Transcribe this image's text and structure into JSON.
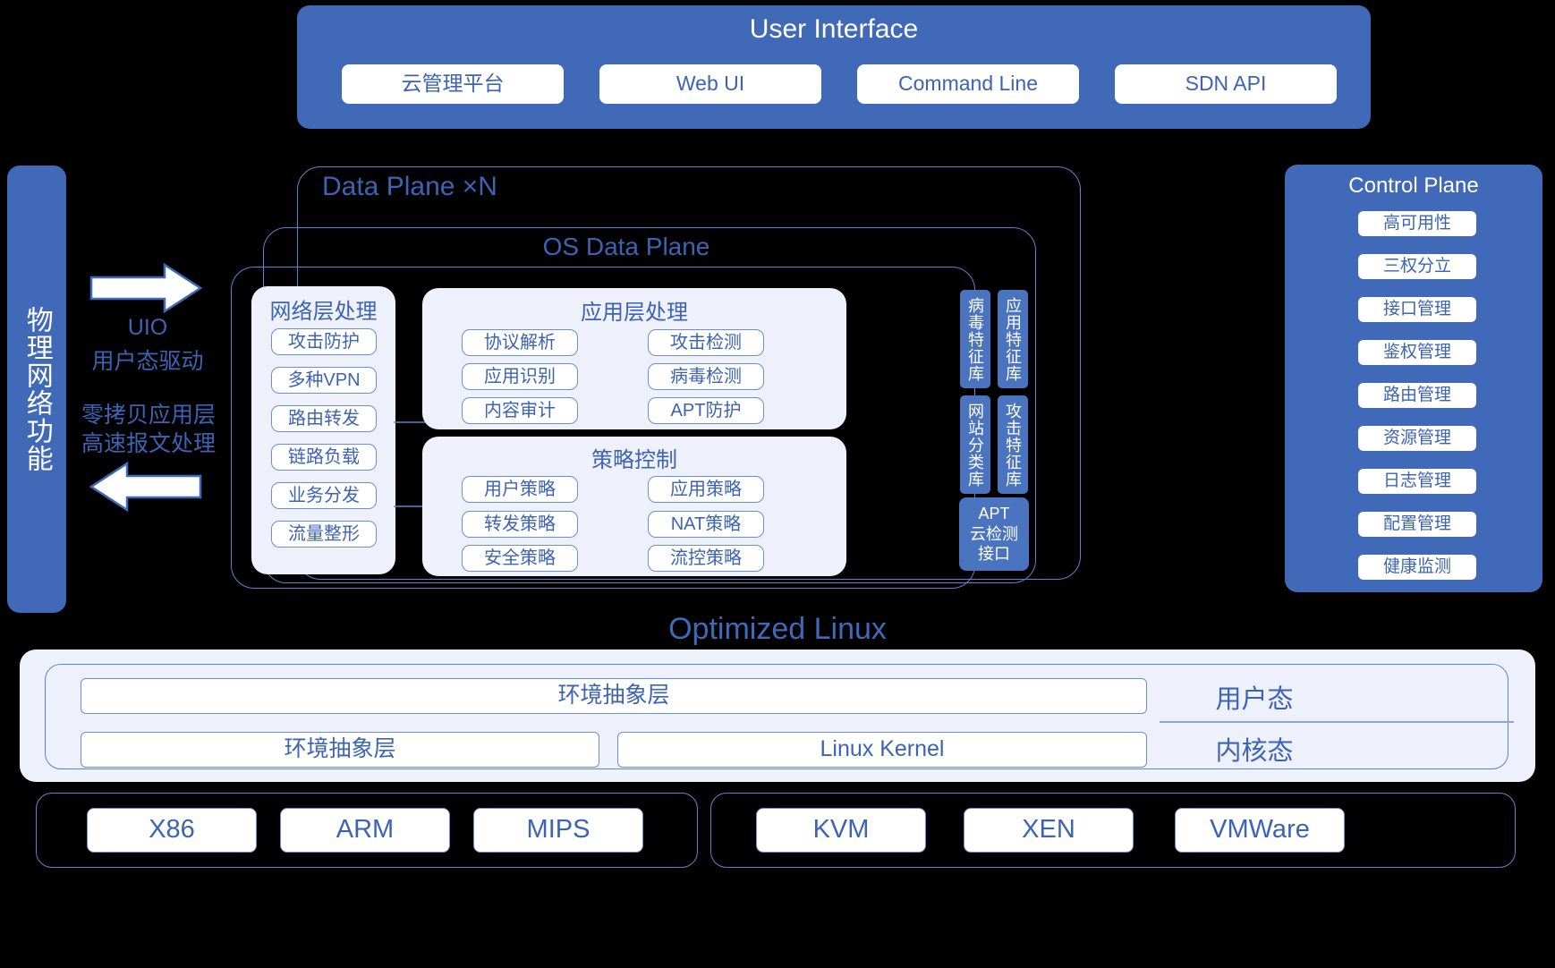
{
  "user_interface": {
    "title": "User Interface",
    "items": [
      "云管理平台",
      "Web UI",
      "Command Line",
      "SDN API"
    ]
  },
  "physical_network": {
    "label": "物理网络功能"
  },
  "flow": {
    "up_arrow_icon": "arrow-right-icon",
    "down_arrow_icon": "arrow-left-icon",
    "up_label_line1": "UIO",
    "up_label_line2": "用户态驱动",
    "down_label_line1": "零拷贝应用层",
    "down_label_line2": "高速报文处理"
  },
  "data_plane": {
    "outer_title": "Data Plane ×N",
    "os_title": "OS Data Plane",
    "network_layer": {
      "title": "网络层处理",
      "items": [
        "攻击防护",
        "多种VPN",
        "路由转发",
        "链路负载",
        "业务分发",
        "流量整形"
      ]
    },
    "application_layer": {
      "title": "应用层处理",
      "left_items": [
        "协议解析",
        "应用识别",
        "内容审计"
      ],
      "right_items": [
        "攻击检测",
        "病毒检测",
        "APT防护"
      ]
    },
    "policy_control": {
      "title": "策略控制",
      "left_items": [
        "用户策略",
        "转发策略",
        "安全策略"
      ],
      "right_items": [
        "应用策略",
        "NAT策略",
        "流控策略"
      ]
    },
    "databases": [
      "病毒特征库",
      "应用特征库",
      "网站分类库",
      "攻击特征库"
    ],
    "apt_box": {
      "line1": "APT",
      "line2": "云检测",
      "line3": "接口"
    }
  },
  "control_plane": {
    "title": "Control Plane",
    "items": [
      "高可用性",
      "三权分立",
      "接口管理",
      "鉴权管理",
      "路由管理",
      "资源管理",
      "日志管理",
      "配置管理",
      "健康监测"
    ]
  },
  "optimized_linux": {
    "title": "Optimized Linux",
    "user_space_row": "环境抽象层",
    "kernel_row_left": "环境抽象层",
    "kernel_row_right": "Linux Kernel",
    "user_mode_label": "用户态",
    "kernel_mode_label": "内核态",
    "arch_items": [
      "X86",
      "ARM",
      "MIPS"
    ],
    "virt_items": [
      "KVM",
      "XEN",
      "VMWare"
    ]
  },
  "colors": {
    "brand_blue": "#4069b8",
    "chip_blue": "#4a73c0",
    "text_blue": "#3d63b5",
    "lavender": "#eef1fc",
    "outline": "#6b8fd4",
    "background": "#000000"
  }
}
